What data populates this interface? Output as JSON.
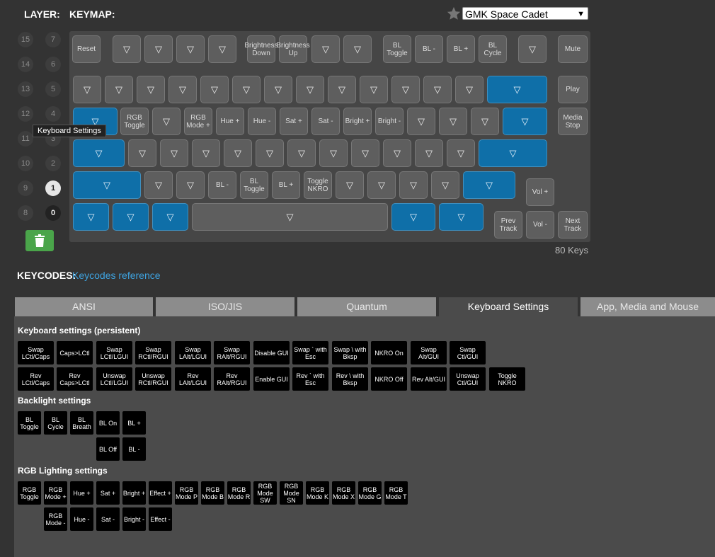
{
  "header": {
    "layer_label": "LAYER:",
    "keymap_label": "KEYMAP:",
    "keymap_select": "GMK Space Cadet",
    "star_icon": "star-icon"
  },
  "layers": [
    "15",
    "7",
    "14",
    "6",
    "13",
    "5",
    "12",
    "4",
    "11",
    "3",
    "10",
    "2",
    "9",
    "1",
    "8",
    "0"
  ],
  "tooltip": "Keyboard Settings",
  "keyboard": {
    "keys": [
      {
        "label": "Reset"
      },
      {
        "label": "▽"
      },
      {
        "label": "▽"
      },
      {
        "label": "▽"
      },
      {
        "label": "▽"
      },
      {
        "label": "Brightness Down"
      },
      {
        "label": "Brightness Up"
      },
      {
        "label": "▽"
      },
      {
        "label": "▽"
      },
      {
        "label": "BL Toggle"
      },
      {
        "label": "BL -"
      },
      {
        "label": "BL +"
      },
      {
        "label": "BL Cycle"
      },
      {
        "label": "▽"
      },
      {
        "label": "Mute"
      },
      {
        "label": "▽"
      },
      {
        "label": "▽"
      },
      {
        "label": "▽"
      },
      {
        "label": "▽"
      },
      {
        "label": "▽"
      },
      {
        "label": "▽"
      },
      {
        "label": "▽"
      },
      {
        "label": "▽"
      },
      {
        "label": "▽"
      },
      {
        "label": "▽"
      },
      {
        "label": "▽"
      },
      {
        "label": "▽"
      },
      {
        "label": "▽"
      },
      {
        "label": "▽"
      },
      {
        "label": "Play"
      },
      {
        "label": "▽"
      },
      {
        "label": "RGB Toggle"
      },
      {
        "label": "▽"
      },
      {
        "label": "RGB Mode +"
      },
      {
        "label": "Hue +"
      },
      {
        "label": "Hue -"
      },
      {
        "label": "Sat +"
      },
      {
        "label": "Sat -"
      },
      {
        "label": "Bright +"
      },
      {
        "label": "Bright -"
      },
      {
        "label": "▽"
      },
      {
        "label": "▽"
      },
      {
        "label": "▽"
      },
      {
        "label": "▽"
      },
      {
        "label": "Media Stop"
      },
      {
        "label": "▽"
      },
      {
        "label": "▽"
      },
      {
        "label": "▽"
      },
      {
        "label": "▽"
      },
      {
        "label": "▽"
      },
      {
        "label": "▽"
      },
      {
        "label": "▽"
      },
      {
        "label": "▽"
      },
      {
        "label": "▽"
      },
      {
        "label": "▽"
      },
      {
        "label": "▽"
      },
      {
        "label": "▽"
      },
      {
        "label": "▽"
      },
      {
        "label": "▽"
      },
      {
        "label": "▽"
      },
      {
        "label": "▽"
      },
      {
        "label": "BL -"
      },
      {
        "label": "BL Toggle"
      },
      {
        "label": "BL +"
      },
      {
        "label": "Toggle NKRO"
      },
      {
        "label": "▽"
      },
      {
        "label": "▽"
      },
      {
        "label": "▽"
      },
      {
        "label": "▽"
      },
      {
        "label": "▽"
      },
      {
        "label": "Vol +"
      },
      {
        "label": "▽"
      },
      {
        "label": "▽"
      },
      {
        "label": "▽"
      },
      {
        "label": "▽"
      },
      {
        "label": "▽"
      },
      {
        "label": "▽"
      },
      {
        "label": "Prev Track"
      },
      {
        "label": "Vol -"
      },
      {
        "label": "Next Track"
      }
    ],
    "count_label": "80 Keys"
  },
  "keycodes": {
    "label": "KEYCODES:",
    "link": "Keycodes reference"
  },
  "tabs": [
    "ANSI",
    "ISO/JIS",
    "Quantum",
    "Keyboard Settings",
    "App, Media and Mouse"
  ],
  "sections": {
    "keyboard_title": "Keyboard settings (persistent)",
    "keyboard_row1": [
      "Swap LCtl/Caps",
      "Caps>LCtl",
      "Swap LCtl/LGUI",
      "Swap RCtl/RGUI",
      "Swap LAlt/LGUI",
      "Swap RAlt/RGUI",
      "Disable GUI",
      "Swap ` with Esc",
      "Swap \\ with Bksp",
      "NKRO On",
      "Swap Alt/GUI",
      "Swap Ctl/GUI"
    ],
    "keyboard_row2": [
      "Rev LCtl/Caps",
      "Rev Caps>LCtl",
      "Unswap LCtl/LGUI",
      "Unswap RCtl/RGUI",
      "Rev LAlt/LGUI",
      "Rev RAlt/RGUI",
      "Enable GUI",
      "Rev ` with Esc",
      "Rev \\ with Bksp",
      "NKRO Off",
      "Rev Alt/GUI",
      "Unswap Ctl/GUI",
      "Toggle NKRO"
    ],
    "backlight_title": "Backlight settings",
    "backlight_row1": [
      "BL Toggle",
      "BL Cycle",
      "BL Breath",
      "BL On",
      "BL +"
    ],
    "backlight_row2": [
      "BL Off",
      "BL -"
    ],
    "rgb_title": "RGB Lighting settings",
    "rgb_row1": [
      "RGB Toggle",
      "RGB Mode +",
      "Hue +",
      "Sat +",
      "Bright +",
      "Effect +",
      "RGB Mode P",
      "RGB Mode B",
      "RGB Mode R",
      "RGB Mode SW",
      "RGB Mode SN",
      "RGB Mode K",
      "RGB Mode X",
      "RGB Mode G",
      "RGB Mode T"
    ],
    "rgb_row2": [
      "RGB Mode -",
      "Hue -",
      "Sat -",
      "Bright -",
      "Effect -"
    ]
  }
}
